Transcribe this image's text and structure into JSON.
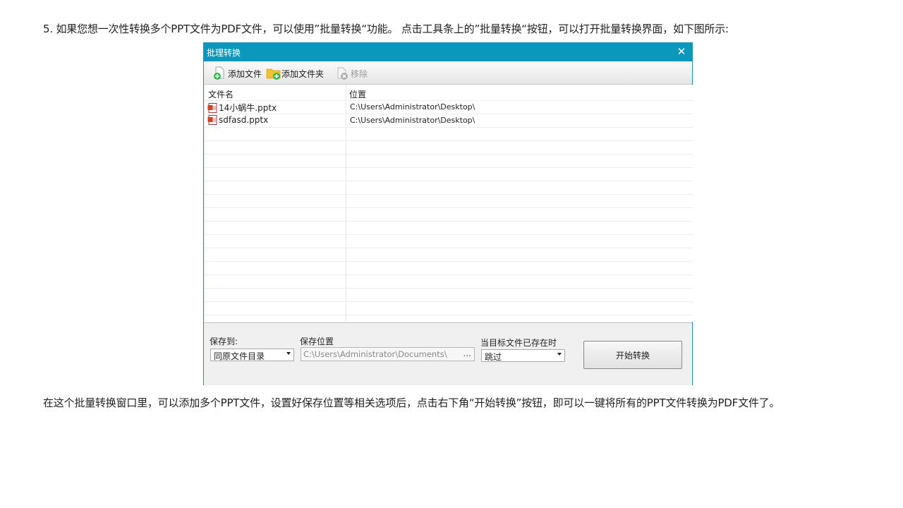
{
  "article": {
    "step5": "5. 如果您想一次性转换多个PPT文件为PDF文件，可以使用”批量转换“功能。 点击工具条上的”批量转换“按钮，可以打开批量转换界面，如下图所示:",
    "after": "在这个批量转换窗口里，可以添加多个PPT文件，设置好保存位置等相关选项后，点击右下角“开始转换”按钮，即可以一键将所有的PPT文件转换为PDF文件了。"
  },
  "dialog": {
    "title": "批理转换",
    "close": "✕",
    "toolbar": {
      "add_file": "添加文件",
      "add_folder": "添加文件夹",
      "remove": "移除"
    },
    "columns": {
      "name": "文件名",
      "location": "位置"
    },
    "files": [
      {
        "name": "14小蜗牛.pptx",
        "location": "C:\\Users\\Administrator\\Desktop\\"
      },
      {
        "name": "sdfasd.pptx",
        "location": "C:\\Users\\Administrator\\Desktop\\"
      }
    ],
    "save_to_label": "保存到:",
    "save_to_value": "同原文件目录",
    "save_location_label": "保存位置",
    "save_location_value": "C:\\Users\\Administrator\\Documents\\",
    "browse": "...",
    "exists_label": "当目标文件已存在时",
    "exists_value": "跳过",
    "start_button": "开始转换"
  },
  "colors": {
    "titlebar": "#0b98bd",
    "add_green": "#2db84a",
    "folder_yellow": "#f2c12e"
  }
}
